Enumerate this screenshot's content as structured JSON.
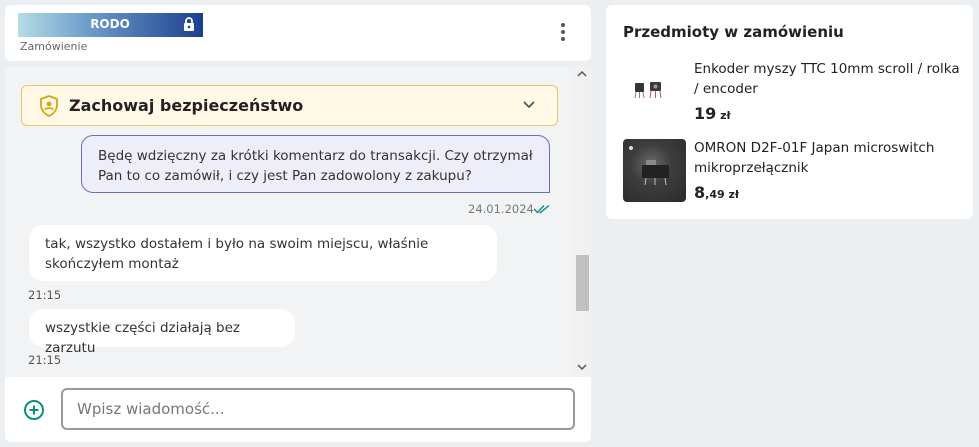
{
  "header": {
    "rodo_label": "RODO",
    "subtitle": "Zamówienie"
  },
  "safety": {
    "title": "Zachowaj bezpieczeństwo"
  },
  "messages": {
    "outgoing": {
      "text": "Będę wdzięczny za krótki komentarz do transakcji. Czy otrzymał Pan to co zamówił, i czy jest Pan zadowolony z zakupu?",
      "date": "24.01.2024"
    },
    "incoming": [
      {
        "text": "tak, wszystko dostałem i było na swoim miejscu, właśnie skończyłem montaż",
        "time": "21:15"
      },
      {
        "text": "wszystkie części działają bez zarzutu",
        "time": "21:15"
      }
    ]
  },
  "composer": {
    "placeholder": "Wpisz wiadomość..."
  },
  "items_panel": {
    "title": "Przedmioty w zamówieniu",
    "items": [
      {
        "name": "Enkoder myszy TTC 10mm scroll / rolka / encoder",
        "price_main": "19",
        "price_sub": " zł"
      },
      {
        "name": "OMRON D2F-01F Japan microswitch mikroprzełącznik",
        "price_main": "8",
        "price_sub": ",49 zł"
      }
    ]
  },
  "colors": {
    "accent_teal": "#0a8f82",
    "outgoing_border": "#6b6fb5",
    "safety_border": "#e8c66a",
    "rodo_gradient_end": "#1b3f8f"
  }
}
